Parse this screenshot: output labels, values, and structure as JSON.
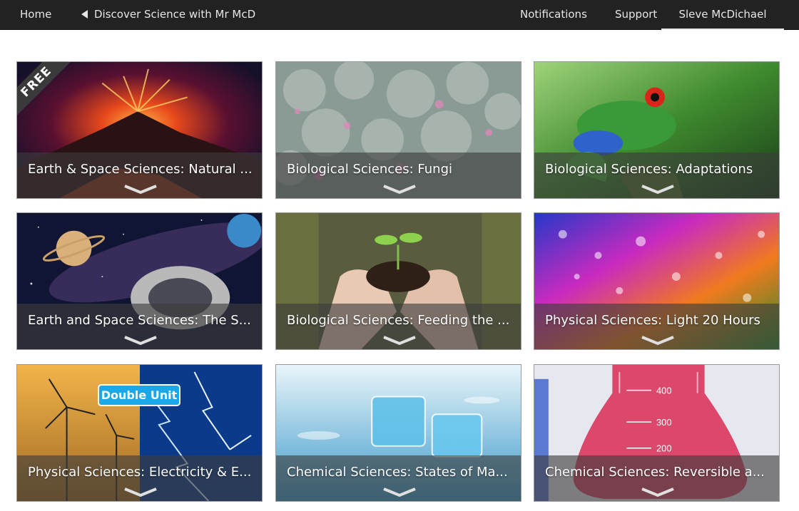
{
  "nav": {
    "home": "Home",
    "course": "Discover Science with Mr McD",
    "notifications": "Notifications",
    "support": "Support",
    "user": "Sleve McDichael"
  },
  "cards": [
    {
      "title": "Earth & Space Sciences: Natural ...",
      "ribbon": "FREE"
    },
    {
      "title": "Biological Sciences: Fungi"
    },
    {
      "title": "Biological Sciences: Adaptations"
    },
    {
      "title": "Earth and Space Sciences: The S..."
    },
    {
      "title": "Biological Sciences: Feeding the ..."
    },
    {
      "title": "Physical Sciences: Light   20 Hours"
    },
    {
      "title": "Physical Sciences: Electricity & E...",
      "badge": "Double Unit"
    },
    {
      "title": "Chemical Sciences: States of Ma..."
    },
    {
      "title": "Chemical Sciences: Reversible a...",
      "flask_labels": [
        "400",
        "300",
        "200"
      ]
    }
  ],
  "icons": {
    "back": "back-triangle-icon",
    "expand": "chevron-down-icon"
  }
}
